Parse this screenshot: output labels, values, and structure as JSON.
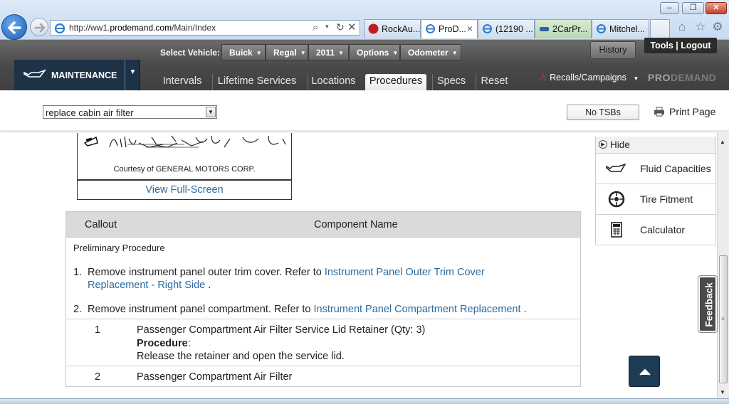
{
  "browser": {
    "url_prefix": "http://ww1.",
    "url_domain": "prodemand.com",
    "url_path": "/Main/Index",
    "tabs": [
      {
        "label": "RockAu...",
        "active": false
      },
      {
        "label": "ProD...",
        "active": true
      },
      {
        "label": "(12190 ...",
        "active": false
      },
      {
        "label": "2CarPr...",
        "active": false
      },
      {
        "label": "Mitchel...",
        "active": false
      }
    ],
    "tab_close_glyph": "×"
  },
  "header": {
    "select_vehicle_label": "Select Vehicle:",
    "vehicle": [
      {
        "label": "Buick"
      },
      {
        "label": "Regal"
      },
      {
        "label": "2011"
      },
      {
        "label": "Options"
      },
      {
        "label": "Odometer"
      }
    ],
    "history_label": "History",
    "tools_logout": "Tools | Logout",
    "module_label": "MAINTENANCE",
    "nav_tabs": [
      {
        "label": "Intervals",
        "active": false
      },
      {
        "label": "Lifetime Services",
        "active": false
      },
      {
        "label": "Locations",
        "active": false
      },
      {
        "label": "Procedures",
        "active": true
      },
      {
        "label": "Specs",
        "active": false
      },
      {
        "label": "Reset",
        "active": false
      }
    ],
    "recalls_label": "Recalls/Campaigns",
    "brand_pro": "PRO",
    "brand_demand": "DEMAND"
  },
  "toolbar": {
    "search_value": "replace cabin air filter",
    "no_tsbs_label": "No TSBs",
    "print_label": "Print Page"
  },
  "figure": {
    "courtesy": "Courtesy of GENERAL MOTORS CORP.",
    "fullscreen_label": "View Full-Screen"
  },
  "table": {
    "col_callout": "Callout",
    "col_component": "Component Name",
    "preliminary_label": "Preliminary Procedure",
    "steps": [
      {
        "num": "1.",
        "text": "Remove instrument panel outer trim cover. Refer to ",
        "link": "Instrument Panel Outer Trim Cover Replacement - Right Side",
        "end": " ."
      },
      {
        "num": "2.",
        "text": "Remove instrument panel compartment. Refer to ",
        "link": "Instrument Panel Compartment Replacement",
        "end": " ."
      }
    ],
    "rows": [
      {
        "callout": "1",
        "name": "Passenger Compartment Air Filter Service Lid Retainer (Qty: 3)",
        "proc_label": "Procedure",
        "proc_colon": ":",
        "proc_text": "Release the retainer and open the service lid."
      },
      {
        "callout": "2",
        "name": "Passenger Compartment Air Filter"
      }
    ]
  },
  "right_panel": {
    "hide_label": "Hide",
    "items": [
      {
        "label": "Fluid Capacities",
        "icon": "oil-can-icon"
      },
      {
        "label": "Tire Fitment",
        "icon": "tire-icon"
      },
      {
        "label": "Calculator",
        "icon": "calculator-icon"
      }
    ]
  },
  "feedback_label": "Feedback",
  "colors": {
    "link": "#2c6aa0",
    "header_dark": "#4a4a4a",
    "module_bg": "#1d3247",
    "top_button": "#1e3c55"
  }
}
